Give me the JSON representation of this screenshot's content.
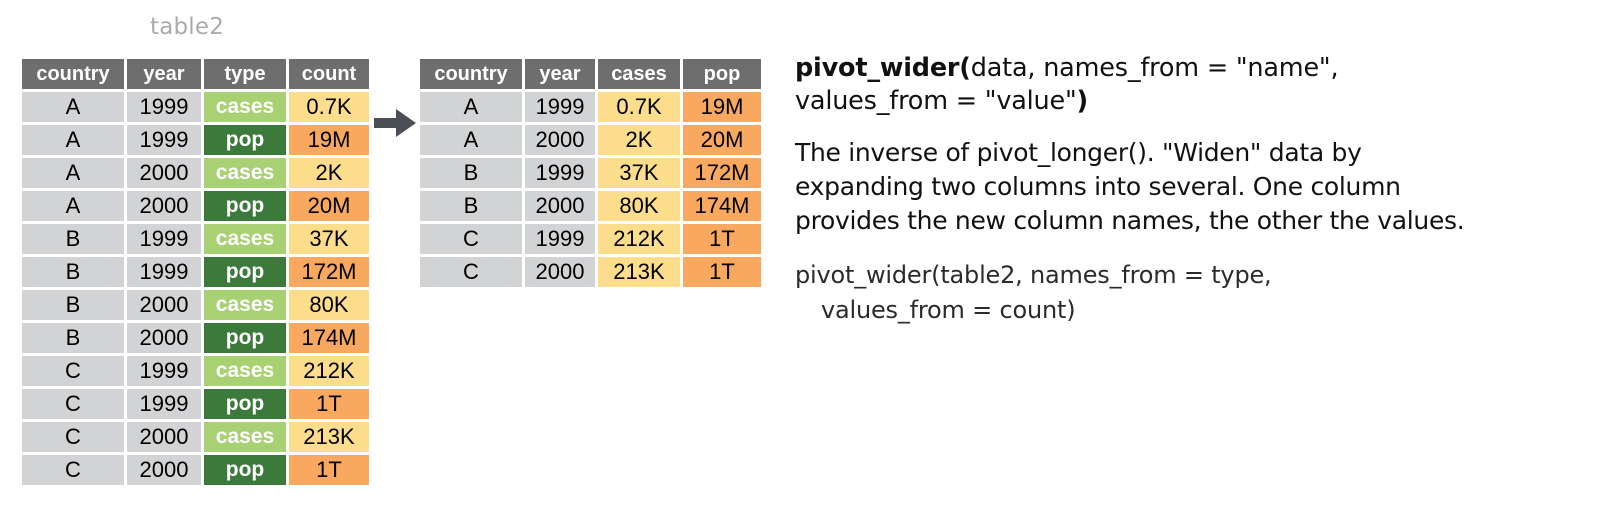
{
  "left_table": {
    "title": "table2",
    "columns": [
      {
        "key": "country",
        "label": "country",
        "header_style": "grey"
      },
      {
        "key": "year",
        "label": "year",
        "header_style": "grey"
      },
      {
        "key": "type",
        "label": "type",
        "header_style": "grey"
      },
      {
        "key": "count",
        "label": "count",
        "header_style": "grey"
      }
    ],
    "rows": [
      {
        "country": "A",
        "year": "1999",
        "type": "cases",
        "count": "0.7K"
      },
      {
        "country": "A",
        "year": "1999",
        "type": "pop",
        "count": "19M"
      },
      {
        "country": "A",
        "year": "2000",
        "type": "cases",
        "count": "2K"
      },
      {
        "country": "A",
        "year": "2000",
        "type": "pop",
        "count": "20M"
      },
      {
        "country": "B",
        "year": "1999",
        "type": "cases",
        "count": "37K"
      },
      {
        "country": "B",
        "year": "1999",
        "type": "pop",
        "count": "172M"
      },
      {
        "country": "B",
        "year": "2000",
        "type": "cases",
        "count": "80K"
      },
      {
        "country": "B",
        "year": "2000",
        "type": "pop",
        "count": "174M"
      },
      {
        "country": "C",
        "year": "1999",
        "type": "cases",
        "count": "212K"
      },
      {
        "country": "C",
        "year": "1999",
        "type": "pop",
        "count": "1T"
      },
      {
        "country": "C",
        "year": "2000",
        "type": "cases",
        "count": "213K"
      },
      {
        "country": "C",
        "year": "2000",
        "type": "pop",
        "count": "1T"
      }
    ]
  },
  "right_table": {
    "columns": [
      {
        "key": "country",
        "label": "country",
        "header_style": "grey"
      },
      {
        "key": "year",
        "label": "year",
        "header_style": "grey"
      },
      {
        "key": "cases",
        "label": "cases",
        "header_style": "light-green"
      },
      {
        "key": "pop",
        "label": "pop",
        "header_style": "dark-green"
      }
    ],
    "rows": [
      {
        "country": "A",
        "year": "1999",
        "cases": "0.7K",
        "pop": "19M"
      },
      {
        "country": "A",
        "year": "2000",
        "cases": "2K",
        "pop": "20M"
      },
      {
        "country": "B",
        "year": "1999",
        "cases": "37K",
        "pop": "172M"
      },
      {
        "country": "B",
        "year": "2000",
        "cases": "80K",
        "pop": "174M"
      },
      {
        "country": "C",
        "year": "1999",
        "cases": "212K",
        "pop": "1T"
      },
      {
        "country": "C",
        "year": "2000",
        "cases": "213K",
        "pop": "1T"
      }
    ]
  },
  "arrow": {
    "name": "right-arrow",
    "color": "#4a4f55"
  },
  "panel": {
    "signature_bold": "pivot_wider(",
    "signature_args": "data, names_from = \"name\", values_from = \"value\"",
    "signature_close": ")",
    "description": "The inverse of pivot_longer(). \"Widen\" data by expanding two columns into several. One column provides the new column names, the other the values.",
    "example_line1": "pivot_wider(table2, names_from = type,",
    "example_line2": "values_from = count)"
  },
  "colors": {
    "header_grey": "#6e6e6e",
    "cell_grey": "#d2d3d5",
    "yellow": "#fcdd8b",
    "orange": "#f9a95f",
    "light_green": "#a8d174",
    "dark_green": "#3c7a3c",
    "title_grey": "#a9abab",
    "text_black": "#111111",
    "code_grey": "#2b2b2b"
  }
}
